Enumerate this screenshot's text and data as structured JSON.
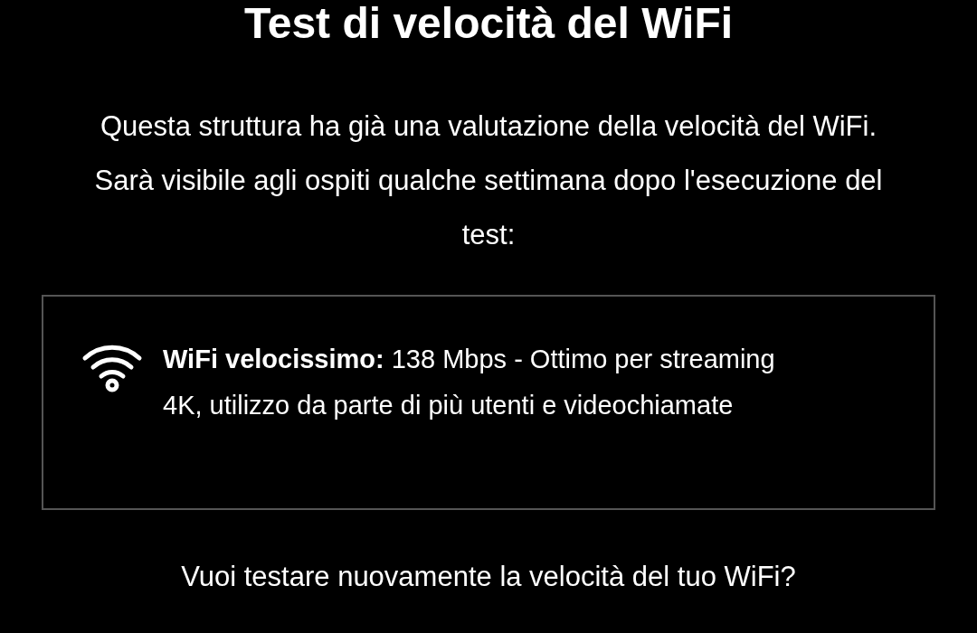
{
  "title": "Test di velocità del WiFi",
  "description": "Questa struttura ha già una valutazione della velocità del WiFi. Sarà visibile agli ospiti qualche settimana dopo l'esecuzione del test:",
  "rating": {
    "text": "**WiFi velocissimo:** 138 Mbps - Ottimo per streaming 4K, utilizzo da parte di più utenti e videochiamate"
  },
  "question": "Vuoi testare nuovamente la velocità del tuo WiFi?"
}
